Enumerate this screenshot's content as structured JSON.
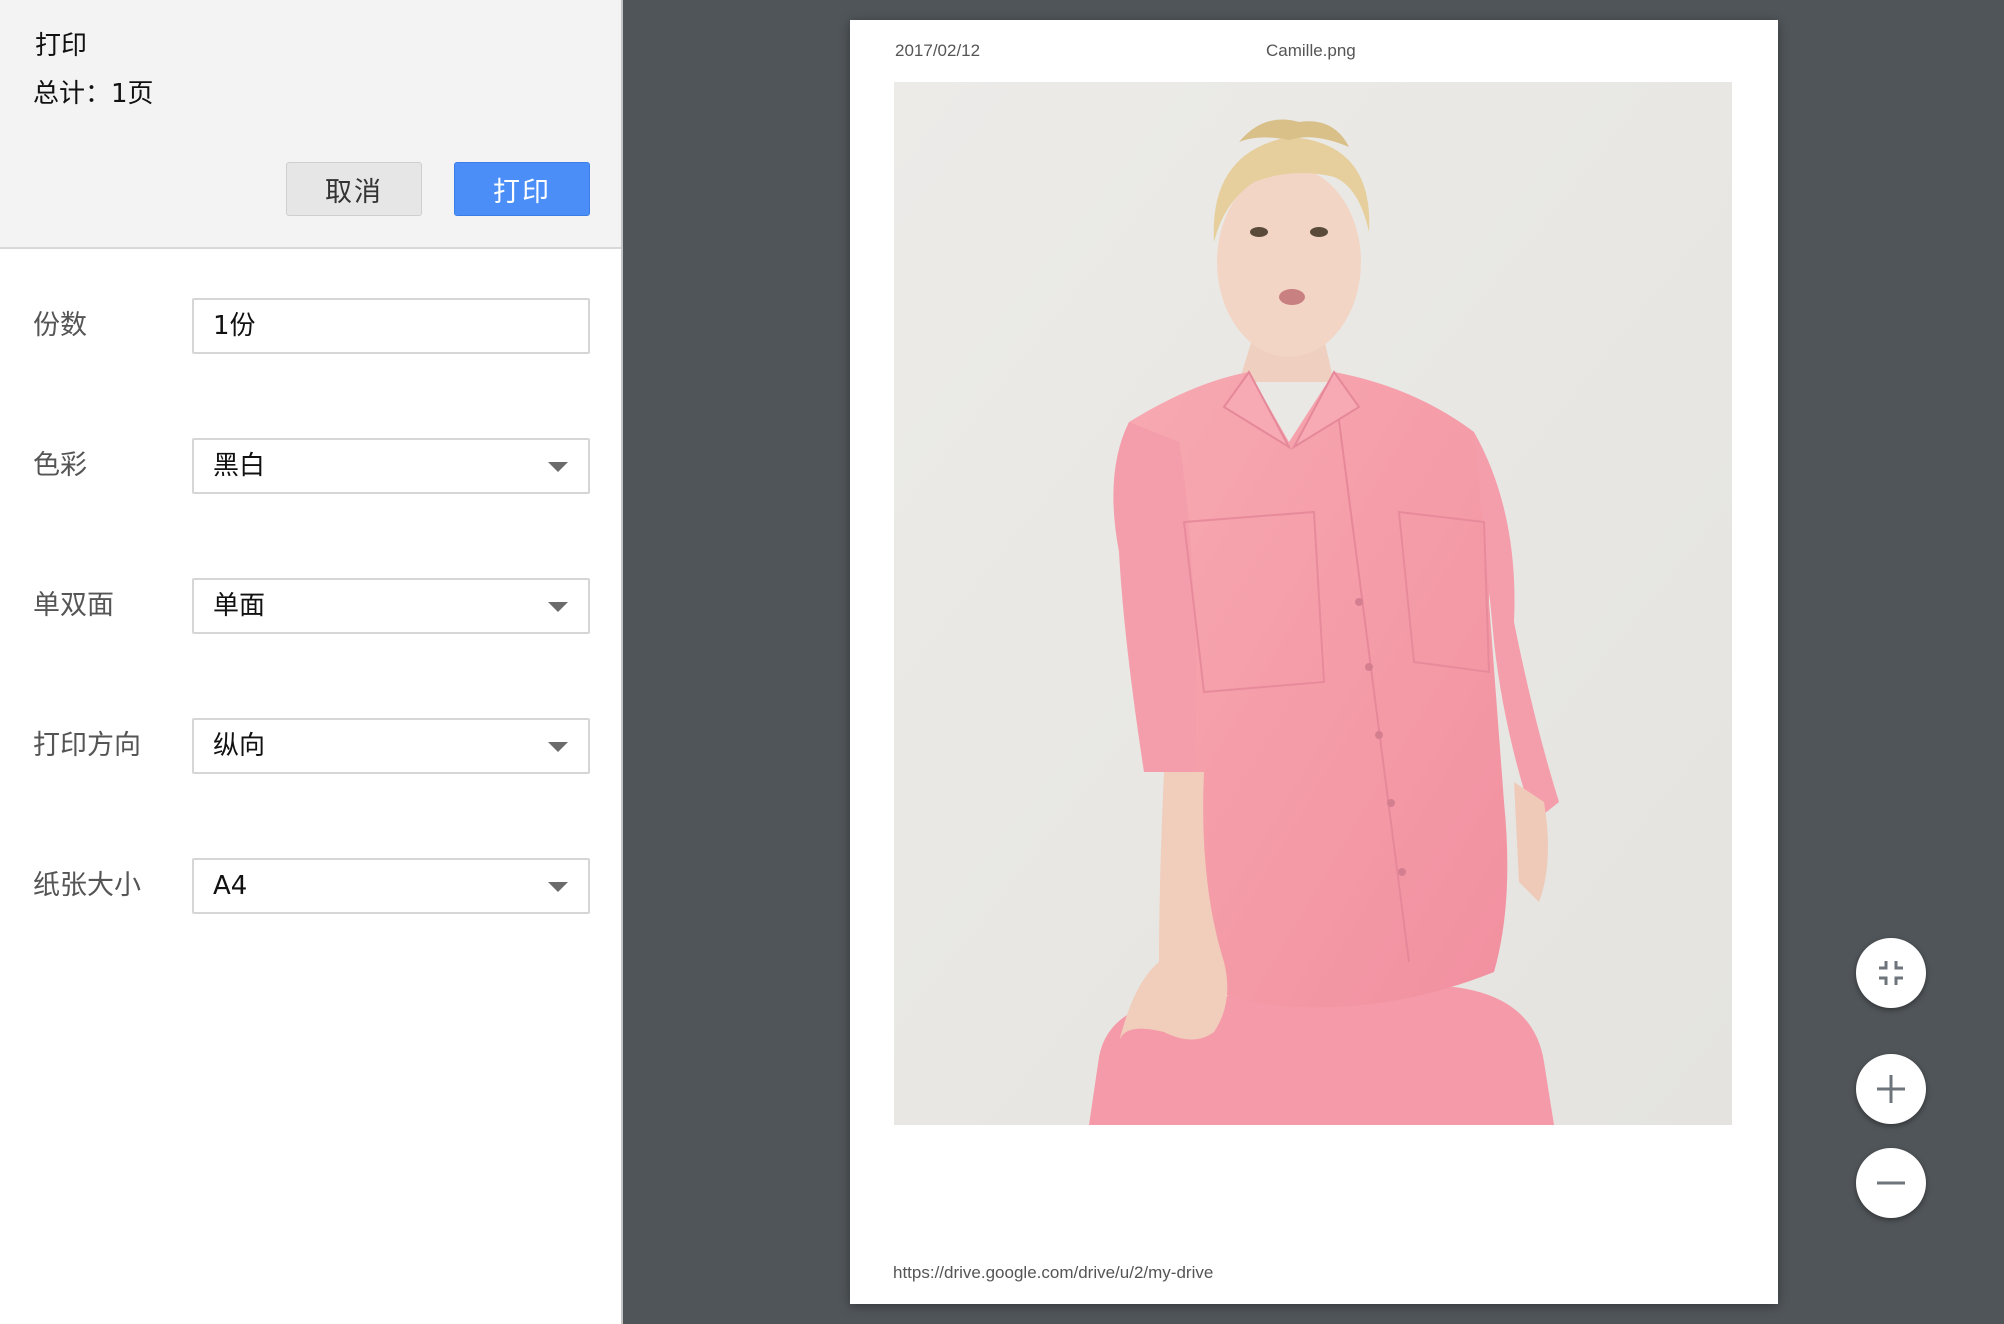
{
  "panel": {
    "title": "打印",
    "page_total": "总计：1页",
    "cancel_label": "取消",
    "print_label": "打印"
  },
  "settings": {
    "copies": {
      "label": "份数",
      "value": "1份"
    },
    "color": {
      "label": "色彩",
      "value": "黑白"
    },
    "duplex": {
      "label": "单双面",
      "value": "单面"
    },
    "orientation": {
      "label": "打印方向",
      "value": "纵向"
    },
    "paper_size": {
      "label": "纸张大小",
      "value": "A4"
    }
  },
  "preview": {
    "date": "2017/02/12",
    "filename": "Camille.png",
    "url": "https://drive.google.com/drive/u/2/my-drive"
  },
  "colors": {
    "accent": "#4c8ef7",
    "preview_background": "#505559",
    "shirt": "#f5a3ab"
  },
  "icons": {
    "fit": "fit-to-page-icon",
    "zoom_in": "plus-icon",
    "zoom_out": "minus-icon"
  }
}
